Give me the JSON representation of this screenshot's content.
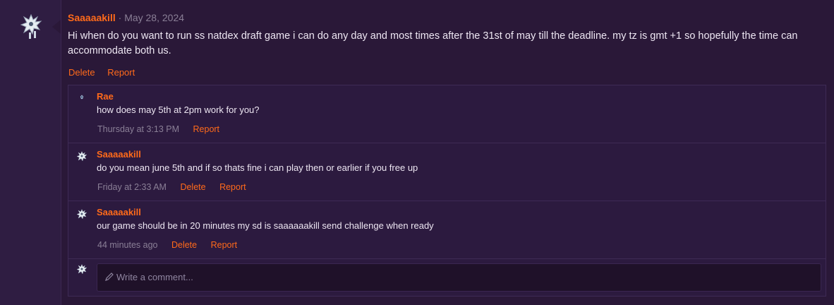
{
  "post": {
    "author": "Saaaaakill",
    "separator": "·",
    "date": "May 28, 2024",
    "body": "Hi when do you want to run ss natdex draft game i can do any day and most times after the 31st of may till the deadline. my tz is gmt +1 so hopefully the time can accommodate both us.",
    "actions": {
      "delete": "Delete",
      "report": "Report"
    },
    "avatar_icon": "arceus-sprite-icon"
  },
  "comments": [
    {
      "author": "Rae",
      "text": "how does may 5th at 2pm work for you?",
      "time": "Thursday at 3:13 PM",
      "actions": [
        "Report"
      ],
      "avatar_icon": "small-sprite-icon"
    },
    {
      "author": "Saaaaakill",
      "text": "do you mean june 5th and if so thats fine i can play then or earlier if you free up",
      "time": "Friday at 2:33 AM",
      "actions": [
        "Delete",
        "Report"
      ],
      "avatar_icon": "arceus-sprite-icon"
    },
    {
      "author": "Saaaaakill",
      "text": "our game should be in 20 minutes my sd is saaaaaakill send challenge when ready",
      "time": "44 minutes ago",
      "actions": [
        "Delete",
        "Report"
      ],
      "avatar_icon": "arceus-sprite-icon"
    }
  ],
  "composer": {
    "placeholder": "Write a comment...",
    "icon": "pencil-icon"
  },
  "colors": {
    "accent": "#ff6a1a",
    "background": "#2a1838",
    "muted": "#8a7f96"
  }
}
